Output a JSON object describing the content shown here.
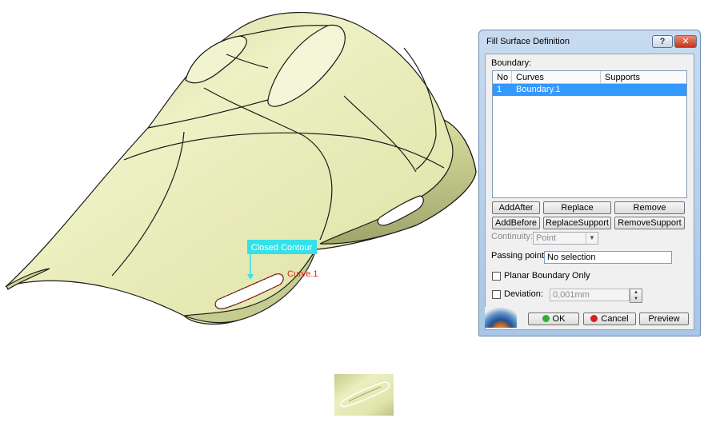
{
  "viewport": {
    "annotations": {
      "closed_contour": "Closed Contour",
      "curve": "Curve.1"
    }
  },
  "dialog": {
    "title": "Fill Surface Definition",
    "help_label": "?",
    "close_label": "✕",
    "boundary_label": "Boundary:",
    "table": {
      "columns": [
        "No",
        "Curves",
        "Supports"
      ],
      "rows": [
        {
          "no": "1",
          "curve": "Boundary.1",
          "support": ""
        }
      ]
    },
    "buttons": {
      "add_after": "AddAfter",
      "replace": "Replace",
      "remove": "Remove",
      "add_before": "AddBefore",
      "replace_support": "ReplaceSupport",
      "remove_support": "RemoveSupport"
    },
    "continuity_label": "Continuity:",
    "continuity_value": "Point",
    "passing_point_label": "Passing point:",
    "passing_point_value": "No selection",
    "planar_boundary_label": "Planar Boundary Only",
    "deviation_label": "Deviation:",
    "deviation_value": "0,001mm",
    "ok_label": "OK",
    "cancel_label": "Cancel",
    "preview_label": "Preview"
  },
  "colors": {
    "surface": "#e8edb8",
    "highlight": "#33e1e8",
    "selection": "#3399ff",
    "curve_label": "#e02020"
  }
}
